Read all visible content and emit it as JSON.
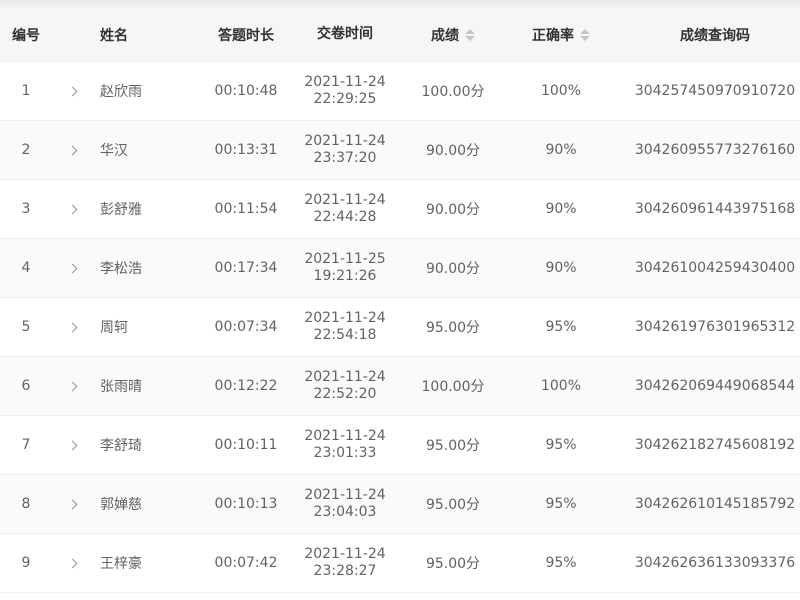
{
  "columns": {
    "no": "编号",
    "name": "姓名",
    "duration": "答题时长",
    "submit_time": "交卷时间",
    "score": "成绩",
    "accuracy": "正确率",
    "query_code": "成绩查询码"
  },
  "icons": {
    "expand": "chevron-right-icon",
    "sort": "sort-caret-icon"
  },
  "colors": {
    "header_bg": "#f6f6f7",
    "stripe_bg": "#fafafa",
    "text": "#606266",
    "header_text": "#303133",
    "border": "#ebeef5"
  },
  "rows": [
    {
      "no": "1",
      "name": "赵欣雨",
      "duration": "00:10:48",
      "date": "2021-11-24",
      "time": "22:29:25",
      "score": "100.00分",
      "accuracy": "100%",
      "code": "304257450970910720"
    },
    {
      "no": "2",
      "name": "华汉",
      "duration": "00:13:31",
      "date": "2021-11-24",
      "time": "23:37:20",
      "score": "90.00分",
      "accuracy": "90%",
      "code": "304260955773276160"
    },
    {
      "no": "3",
      "name": "彭舒雅",
      "duration": "00:11:54",
      "date": "2021-11-24",
      "time": "22:44:28",
      "score": "90.00分",
      "accuracy": "90%",
      "code": "304260961443975168"
    },
    {
      "no": "4",
      "name": "李松浩",
      "duration": "00:17:34",
      "date": "2021-11-25",
      "time": "19:21:26",
      "score": "90.00分",
      "accuracy": "90%",
      "code": "304261004259430400"
    },
    {
      "no": "5",
      "name": "周轲",
      "duration": "00:07:34",
      "date": "2021-11-24",
      "time": "22:54:18",
      "score": "95.00分",
      "accuracy": "95%",
      "code": "304261976301965312"
    },
    {
      "no": "6",
      "name": "张雨晴",
      "duration": "00:12:22",
      "date": "2021-11-24",
      "time": "22:52:20",
      "score": "100.00分",
      "accuracy": "100%",
      "code": "304262069449068544"
    },
    {
      "no": "7",
      "name": "李舒琦",
      "duration": "00:10:11",
      "date": "2021-11-24",
      "time": "23:01:33",
      "score": "95.00分",
      "accuracy": "95%",
      "code": "304262182745608192"
    },
    {
      "no": "8",
      "name": "郭婵慈",
      "duration": "00:10:13",
      "date": "2021-11-24",
      "time": "23:04:03",
      "score": "95.00分",
      "accuracy": "95%",
      "code": "304262610145185792"
    },
    {
      "no": "9",
      "name": "王梓豪",
      "duration": "00:07:42",
      "date": "2021-11-24",
      "time": "23:28:27",
      "score": "95.00分",
      "accuracy": "95%",
      "code": "304262636133093376"
    }
  ]
}
